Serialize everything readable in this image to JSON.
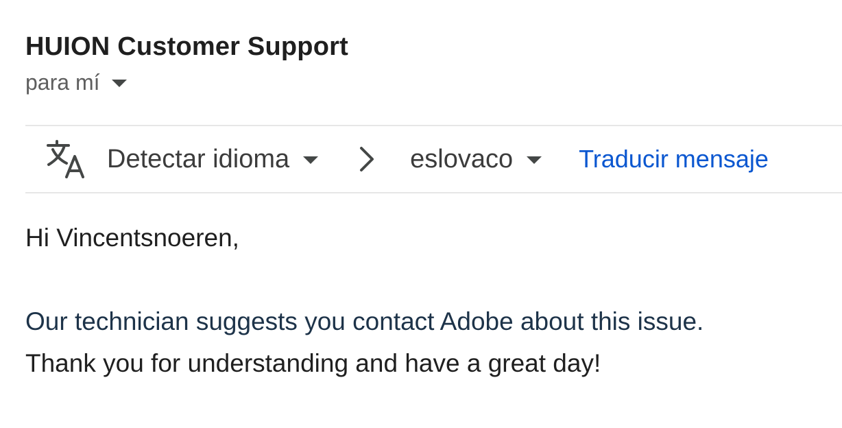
{
  "email": {
    "sender": "HUION Customer Support",
    "recipient": "para mí"
  },
  "translate_bar": {
    "icon": "translate-icon",
    "source_language": "Detectar idioma",
    "arrow_icon": "chevron-right-icon",
    "target_language": "eslovaco",
    "action_label": "Traducir mensaje",
    "action_color": "#0b57d0"
  },
  "message": {
    "greeting": "Hi Vincentsnoeren,",
    "line1": "Our technician suggests you contact Adobe about this issue.",
    "line2": "Thank you for understanding and have a great day!"
  },
  "colors": {
    "text": "#1f1f1f",
    "muted": "#5e5e5e",
    "link": "#0b57d0",
    "quoted_line": "#1d3349",
    "divider": "#e6e6e6"
  }
}
